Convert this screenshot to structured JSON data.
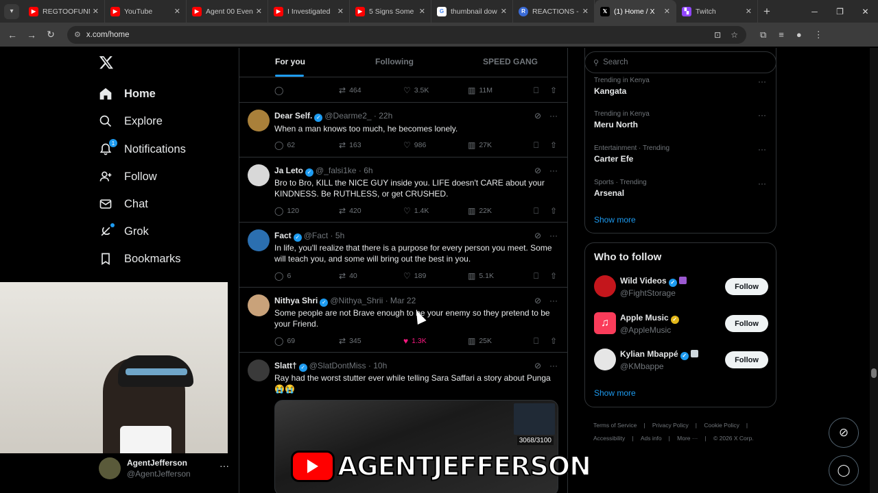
{
  "browser": {
    "tabs": [
      {
        "label": "REGTOOFUNNY",
        "favicon": "youtube-icon",
        "color": "#ff0000"
      },
      {
        "label": "YouTube",
        "favicon": "youtube-icon",
        "color": "#ff0000"
      },
      {
        "label": "Agent 00 Even",
        "favicon": "youtube-icon",
        "color": "#ff0000"
      },
      {
        "label": "I Investigated",
        "favicon": "youtube-icon",
        "color": "#ff0000"
      },
      {
        "label": "5 Signs Some",
        "favicon": "youtube-icon",
        "color": "#ff0000"
      },
      {
        "label": "thumbnail dow",
        "favicon": "google-icon",
        "color": "#4285f4"
      },
      {
        "label": "REACTIONS - I",
        "favicon": "r-icon",
        "color": "#3a6bd6"
      },
      {
        "label": "(1) Home / X",
        "favicon": "x-icon",
        "color": "#000000",
        "active": true
      },
      {
        "label": "Twitch",
        "favicon": "twitch-icon",
        "color": "#9146ff"
      }
    ],
    "url": "x.com/home"
  },
  "nav": {
    "items": [
      {
        "label": "Home",
        "icon": "home-icon"
      },
      {
        "label": "Explore",
        "icon": "search-icon"
      },
      {
        "label": "Notifications",
        "icon": "bell-icon",
        "badge": "1"
      },
      {
        "label": "Follow",
        "icon": "follow-icon"
      },
      {
        "label": "Chat",
        "icon": "mail-icon"
      },
      {
        "label": "Grok",
        "icon": "grok-icon"
      },
      {
        "label": "Bookmarks",
        "icon": "bookmark-icon"
      }
    ]
  },
  "account": {
    "name": "AgentJefferson",
    "handle": "@AgentJefferson"
  },
  "timeline": {
    "tabs": [
      "For you",
      "Following",
      "SPEED GANG"
    ],
    "top_actions": {
      "reposts": "464",
      "likes": "3.5K",
      "views": "11M"
    },
    "posts": [
      {
        "name": "Dear Self.",
        "handle": "@Dearme2_",
        "time": "22h",
        "text": "When a man knows too much, he becomes lonely.",
        "replies": "62",
        "reposts": "163",
        "likes": "986",
        "views": "27K"
      },
      {
        "name": "Ja Leto",
        "handle": "@_falsi1ke",
        "time": "6h",
        "text": "Bro to Bro, KILL the NICE GUY inside you. LIFE doesn't CARE about your KINDNESS. Be RUTHLESS, or get CRUSHED.",
        "replies": "120",
        "reposts": "420",
        "likes": "1.4K",
        "views": "22K"
      },
      {
        "name": "Fact",
        "handle": "@Fact",
        "time": "5h",
        "text": "In life, you'll realize that there is a purpose for every person you meet. Some will teach you, and some will bring out the best in you.",
        "replies": "6",
        "reposts": "40",
        "likes": "189",
        "views": "5.1K"
      },
      {
        "name": "Nithya Shri",
        "handle": "@Nithya_Shrii",
        "time": "Mar 22",
        "text": "Some people are not Brave enough to be your enemy so they pretend to be your Friend.",
        "replies": "69",
        "reposts": "345",
        "likes": "1.3K",
        "views": "25K"
      },
      {
        "name": "Slatt†",
        "handle": "@SlatDontMiss",
        "time": "10h",
        "text": "Ray had the worst stutter ever while telling Sara Saffari a story about Punga 😭😭",
        "media_counter": "3068/3100"
      }
    ]
  },
  "search": {
    "placeholder": "Search"
  },
  "trends": [
    {
      "meta": "Trending in Kenya",
      "name": "Kangata"
    },
    {
      "meta": "Trending in Kenya",
      "name": "Meru North"
    },
    {
      "meta": "Entertainment · Trending",
      "name": "Carter Efe"
    },
    {
      "meta": "Sports · Trending",
      "name": "Arsenal"
    }
  ],
  "show_more": "Show more",
  "who_to_follow": {
    "title": "Who to follow",
    "accounts": [
      {
        "name": "Wild Videos",
        "handle": "@FightStorage",
        "button": "Follow"
      },
      {
        "name": "Apple Music",
        "handle": "@AppleMusic",
        "button": "Follow"
      },
      {
        "name": "Kylian Mbappé",
        "handle": "@KMbappe",
        "button": "Follow"
      }
    ],
    "show_more": "Show more"
  },
  "footer": {
    "links": [
      "Terms of Service",
      "Privacy Policy",
      "Cookie Policy",
      "Accessibility",
      "Ads info",
      "More ···"
    ],
    "copyright": "© 2026 X Corp."
  },
  "overlay": {
    "channel": "AGENTJEFFERSON"
  },
  "colors": {
    "accent": "#1d9bf0",
    "like": "#f91880",
    "border": "#2f3336",
    "muted": "#71767b"
  }
}
